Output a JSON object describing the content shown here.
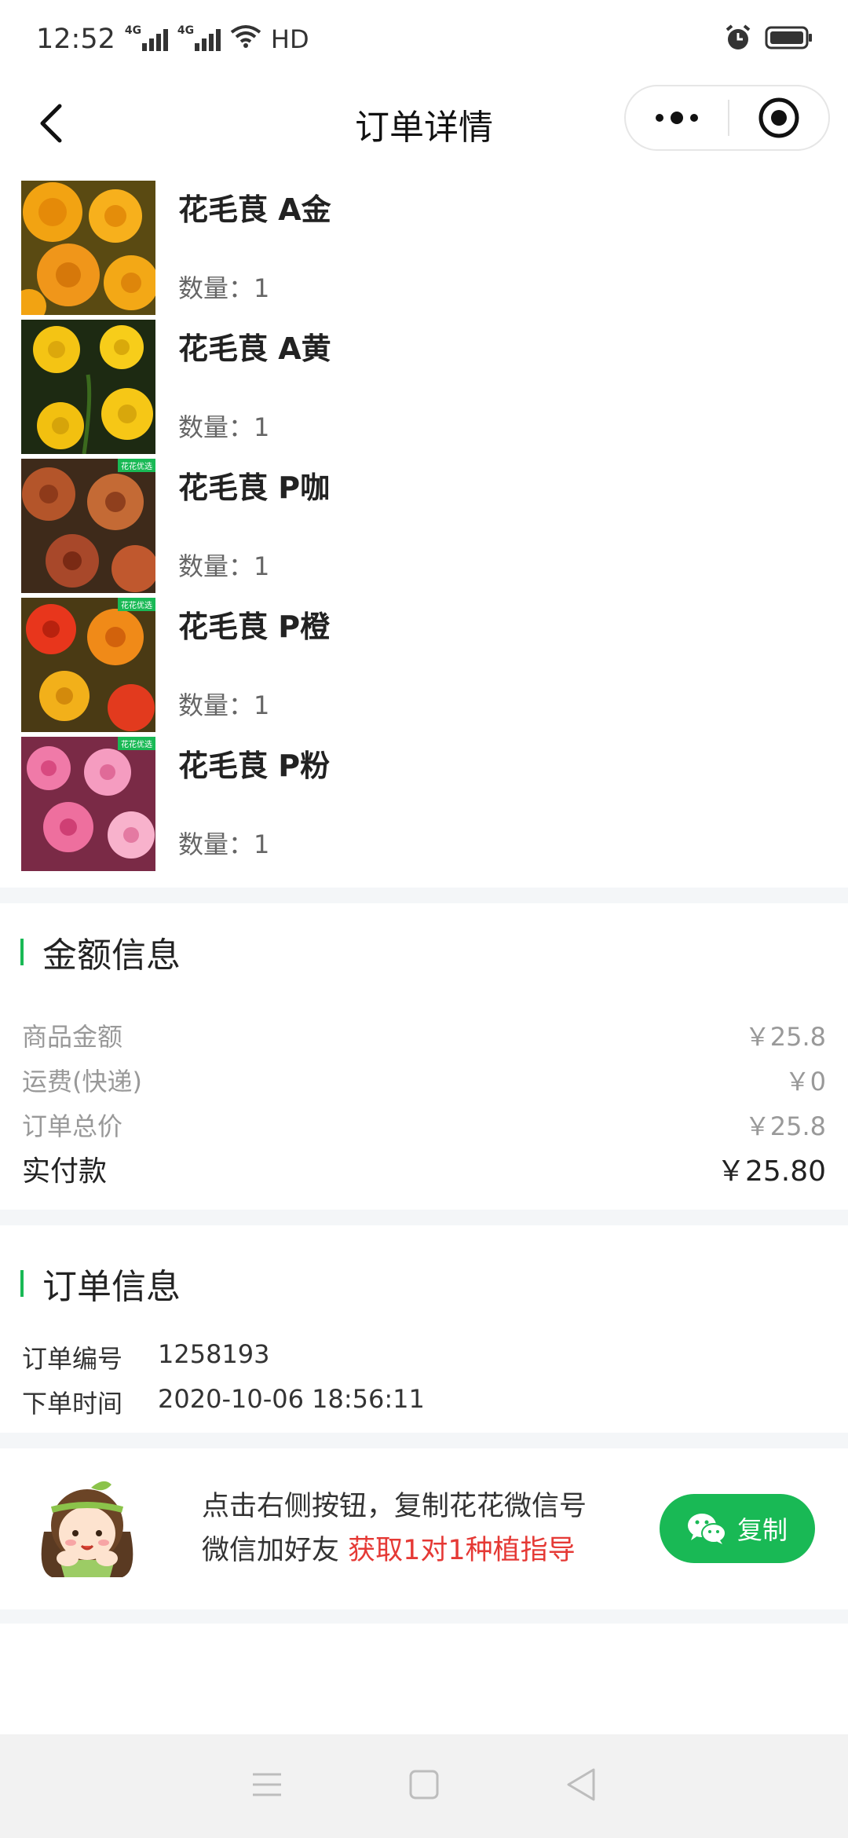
{
  "status": {
    "time": "12:52",
    "network_a": "4G",
    "network_b": "4G",
    "hd": "HD"
  },
  "header": {
    "title": "订单详情"
  },
  "products": [
    {
      "name": "花毛茛 A金",
      "qty_label": "数量：",
      "qty": "1"
    },
    {
      "name": "花毛茛 A黄",
      "qty_label": "数量：",
      "qty": "1"
    },
    {
      "name": "花毛茛 P咖",
      "qty_label": "数量：",
      "qty": "1"
    },
    {
      "name": "花毛茛 P橙",
      "qty_label": "数量：",
      "qty": "1"
    },
    {
      "name": "花毛茛 P粉",
      "qty_label": "数量：",
      "qty": "1"
    }
  ],
  "thumb_tag": "花花优选",
  "amount": {
    "title": "金额信息",
    "rows": [
      {
        "label": "商品金额",
        "value": "￥25.8"
      },
      {
        "label": "运费(快递)",
        "value": "￥0"
      },
      {
        "label": "订单总价",
        "value": "￥25.8"
      }
    ],
    "paid_label": "实付款",
    "paid_value": "￥25.80"
  },
  "order": {
    "title": "订单信息",
    "number_label": "订单编号",
    "number_value": "1258193",
    "time_label": "下单时间",
    "time_value": "2020-10-06 18:56:11"
  },
  "promo": {
    "line1": "点击右侧按钮，复制花花微信号",
    "line2_prefix": "微信加好友 ",
    "line2_highlight": "获取1对1种植指导",
    "button_label": "复制"
  },
  "colors": {
    "accent": "#19b955",
    "highlight": "#e53935",
    "gap": "#f4f6f8"
  }
}
